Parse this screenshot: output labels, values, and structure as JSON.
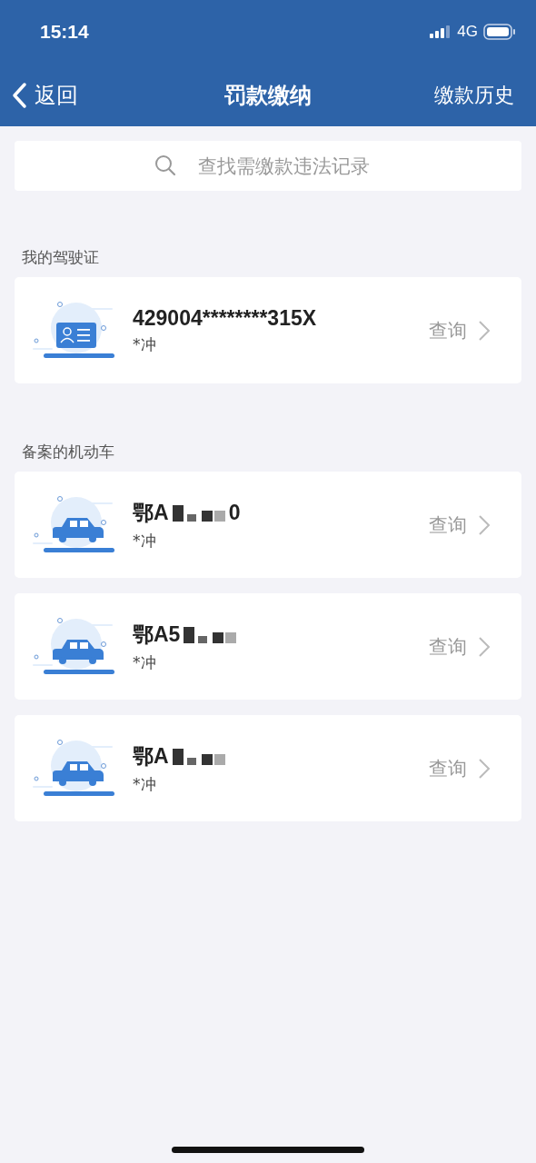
{
  "status_bar": {
    "time": "15:14",
    "network": "4G"
  },
  "nav": {
    "back": "返回",
    "title": "罚款缴纳",
    "action": "缴款历史"
  },
  "search": {
    "placeholder": "查找需缴款违法记录"
  },
  "license_section": {
    "title": "我的驾驶证",
    "items": [
      {
        "kind": "license",
        "number": "429004********315X",
        "name": "*冲",
        "action": "查询"
      }
    ]
  },
  "vehicle_section": {
    "title": "备案的机动车",
    "items": [
      {
        "kind": "car",
        "number": "鄂A",
        "number_end": "0",
        "name": "*冲",
        "action": "查询"
      },
      {
        "kind": "car",
        "number": "鄂A5",
        "name": "*冲",
        "action": "查询"
      },
      {
        "kind": "car",
        "number": "鄂A",
        "name": "*冲",
        "action": "查询"
      }
    ]
  }
}
